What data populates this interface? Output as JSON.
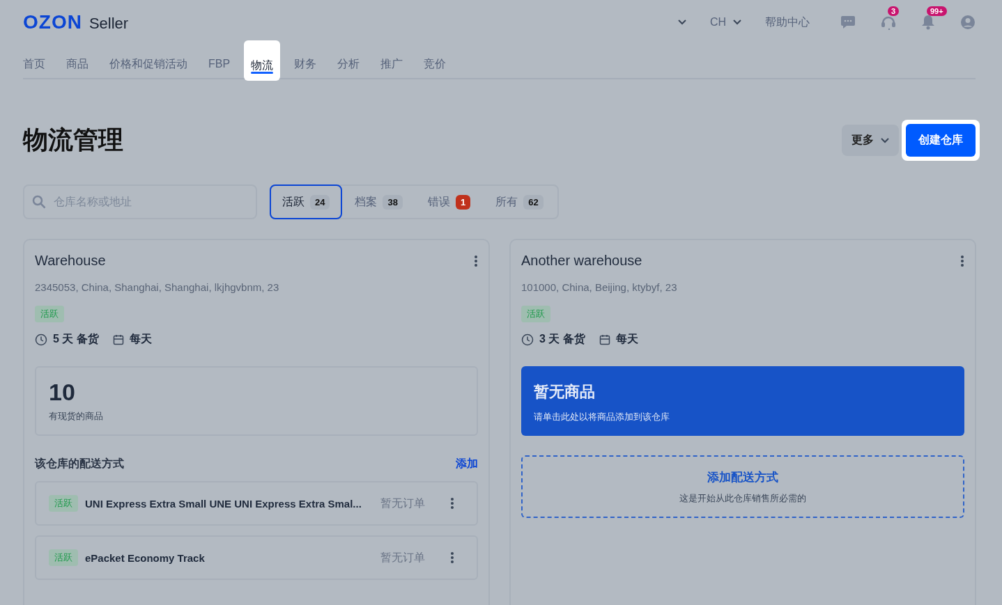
{
  "header": {
    "logo": "OZON",
    "logo_suffix": "Seller",
    "language": "CH",
    "help": "帮助中心",
    "support_badge": "3",
    "notifications_badge": "99+"
  },
  "nav": [
    {
      "label": "首页",
      "selected": false
    },
    {
      "label": "商品",
      "selected": false
    },
    {
      "label": "价格和促销活动",
      "selected": false
    },
    {
      "label": "FBP",
      "selected": false
    },
    {
      "label": "物流",
      "selected": true
    },
    {
      "label": "财务",
      "selected": false
    },
    {
      "label": "分析",
      "selected": false
    },
    {
      "label": "推广",
      "selected": false
    },
    {
      "label": "竞价",
      "selected": false
    }
  ],
  "page": {
    "title": "物流管理",
    "more_button": "更多",
    "create_button": "创建仓库"
  },
  "search": {
    "placeholder": "仓库名称或地址"
  },
  "filters": [
    {
      "label": "活跃",
      "count": "24",
      "selected": true,
      "alert": false
    },
    {
      "label": "档案",
      "count": "38",
      "selected": false,
      "alert": false
    },
    {
      "label": "错误",
      "count": "1",
      "selected": false,
      "alert": true
    },
    {
      "label": "所有",
      "count": "62",
      "selected": false,
      "alert": false
    }
  ],
  "warehouses": [
    {
      "name": "Warehouse",
      "address": "2345053, China, Shanghai, Shanghai, lkjhgvbnm, 23",
      "status": "活跃",
      "prep_time": "5 天 备货",
      "schedule": "每天",
      "stock": {
        "kind": "count",
        "value": "10",
        "label": "有现货的商品"
      },
      "delivery": {
        "kind": "list",
        "title": "该仓库的配送方式",
        "add_link": "添加",
        "methods": [
          {
            "status": "活跃",
            "name": "UNI Express Extra Small UNE UNI Express Extra Smal...",
            "orders": "暂无订单"
          },
          {
            "status": "活跃",
            "name": "ePacket Economy Track",
            "orders": "暂无订单"
          }
        ]
      }
    },
    {
      "name": "Another warehouse",
      "address": "101000, China, Beijing, ktybyf, 23",
      "status": "活跃",
      "prep_time": "3 天 备货",
      "schedule": "每天",
      "stock": {
        "kind": "empty",
        "title": "暂无商品",
        "subtitle": "请单击此处以将商品添加到该仓库"
      },
      "delivery": {
        "kind": "empty",
        "title": "添加配送方式",
        "subtitle": "这是开始从此仓库销售所必需的"
      }
    }
  ]
}
